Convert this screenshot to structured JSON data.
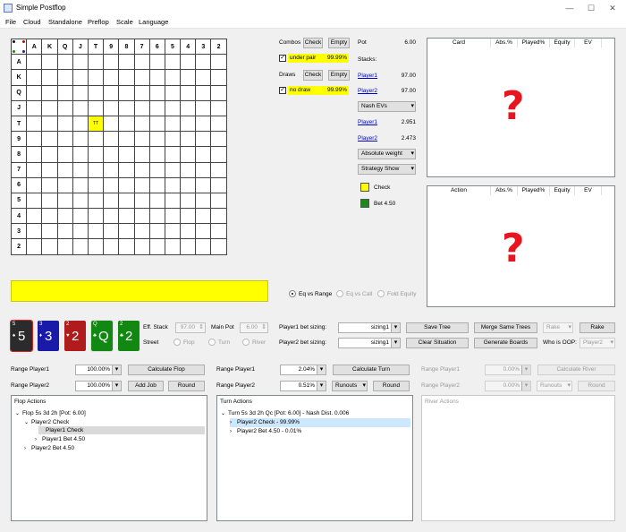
{
  "window": {
    "title": "Simple Postflop",
    "minimize": "—",
    "maximize": "☐",
    "close": "✕"
  },
  "menu": [
    "File",
    "Cloud",
    "Standalone",
    "Preflop",
    "Scale",
    "Language"
  ],
  "grid": {
    "col_headers": [
      "A",
      "K",
      "Q",
      "J",
      "T",
      "9",
      "8",
      "7",
      "6",
      "5",
      "4",
      "3",
      "2"
    ],
    "row_headers": [
      "A",
      "K",
      "Q",
      "J",
      "T",
      "9",
      "8",
      "7",
      "6",
      "5",
      "4",
      "3",
      "2"
    ],
    "highlight_cell": {
      "row": "T",
      "col": "T",
      "label": "TT"
    }
  },
  "combos": {
    "label": "Combos",
    "check": "Check",
    "empty": "Empty",
    "filter_label": "under pair",
    "filter_value": "99.99%"
  },
  "draws": {
    "label": "Draws",
    "check": "Check",
    "empty": "Empty",
    "filter_label": "no draw",
    "filter_value": "99.99%"
  },
  "pot": {
    "label": "Pot",
    "value": "6.00"
  },
  "stacks": {
    "label": "Stacks:",
    "p1": "Player1",
    "p1_value": "97.00",
    "p2": "Player2",
    "p2_value": "97.00"
  },
  "nash": {
    "dropdown": "Nash EVs",
    "p1": "Player1",
    "p1_value": "2.951",
    "p2": "Player2",
    "p2_value": "2.473"
  },
  "weight_dropdown": "Absolute weight",
  "strategy_dropdown": "Strategy Show",
  "legend": [
    {
      "label": "Check",
      "color": "#ffff00"
    },
    {
      "label": "Bet 4.50",
      "color": "#1a8a1a"
    }
  ],
  "card_table": {
    "headers": [
      "Card",
      "Abs.%",
      "Played%",
      "Equity",
      "EV"
    ],
    "empty_mark": "?"
  },
  "action_table": {
    "headers": [
      "Action",
      "Abs.%",
      "Played%",
      "Equity",
      "EV"
    ],
    "empty_mark": "?"
  },
  "eq_radios": [
    "Eq vs Range",
    "Eq vs Call",
    "Fold Equity"
  ],
  "board": [
    {
      "rank": "5",
      "suit": "♠",
      "color": "#2b2b2b",
      "selected": true
    },
    {
      "rank": "3",
      "suit": "♦",
      "color": "#1a1aa8",
      "selected": false
    },
    {
      "rank": "2",
      "suit": "♥",
      "color": "#b01c1c",
      "selected": false
    },
    {
      "rank": "Q",
      "suit": "♣",
      "color": "#118811",
      "selected": true
    },
    {
      "rank": "2",
      "suit": "♣",
      "color": "#118811",
      "selected": false
    }
  ],
  "eff_stack": {
    "label": "Eff. Stack",
    "value": "97.00"
  },
  "main_pot": {
    "label": "Main Pot",
    "value": "6.00"
  },
  "street": {
    "label": "Street",
    "options": [
      "Flop",
      "Turn",
      "River"
    ]
  },
  "bet_sizing": {
    "p1_label": "Player1 bet sizing:",
    "p1_value": "sizing1",
    "p2_label": "Player2 bet sizing:",
    "p2_value": "sizing1"
  },
  "toolbar": {
    "save_tree": "Save Tree",
    "merge_same_trees": "Merge Same Trees",
    "rake_dropdown": "Rake",
    "rake_button": "Rake",
    "clear_situation": "Clear Situation",
    "generate_boards": "Generate Boards",
    "who_is_oop": "Who is OOP:",
    "oop_value": "Player2"
  },
  "flop_ranges": {
    "p1_label": "Range Player1",
    "p1_value": "100.00%",
    "calc": "Calculate Flop",
    "p2_label": "Range Player2",
    "p2_value": "100.00%",
    "add_job": "Add Job",
    "round": "Round"
  },
  "turn_ranges": {
    "p1_label": "Range Player1",
    "p1_value": "2.04%",
    "calc": "Calculate Turn",
    "p2_label": "Range Player2",
    "p2_value": "0.51%",
    "runouts": "Runouts",
    "round": "Round"
  },
  "river_ranges": {
    "p1_label": "Range Player1",
    "p1_value": "0.00%",
    "calc": "Calculate River",
    "p2_label": "Range Player2",
    "p2_value": "0.00%",
    "runouts": "Runouts",
    "round": "Round"
  },
  "flop_actions": {
    "header": "Flop Actions",
    "root": "Flop 5s 3d 2h [Pot: 6.00]",
    "n1": "Player2 Check",
    "n1a": "Player1 Check",
    "n1b": "Player1 Bet 4.50",
    "n2": "Player2 Bet 4.50"
  },
  "turn_actions": {
    "header": "Turn Actions",
    "root": "Turn 5s 3d 2h Qc [Pot: 6.00] - Nash Dist. 0.006",
    "n1": "Player2 Check - 99.99%",
    "n2": "Player2 Bet 4.50 - 0.01%"
  },
  "river_actions": {
    "header": "River Actions"
  }
}
